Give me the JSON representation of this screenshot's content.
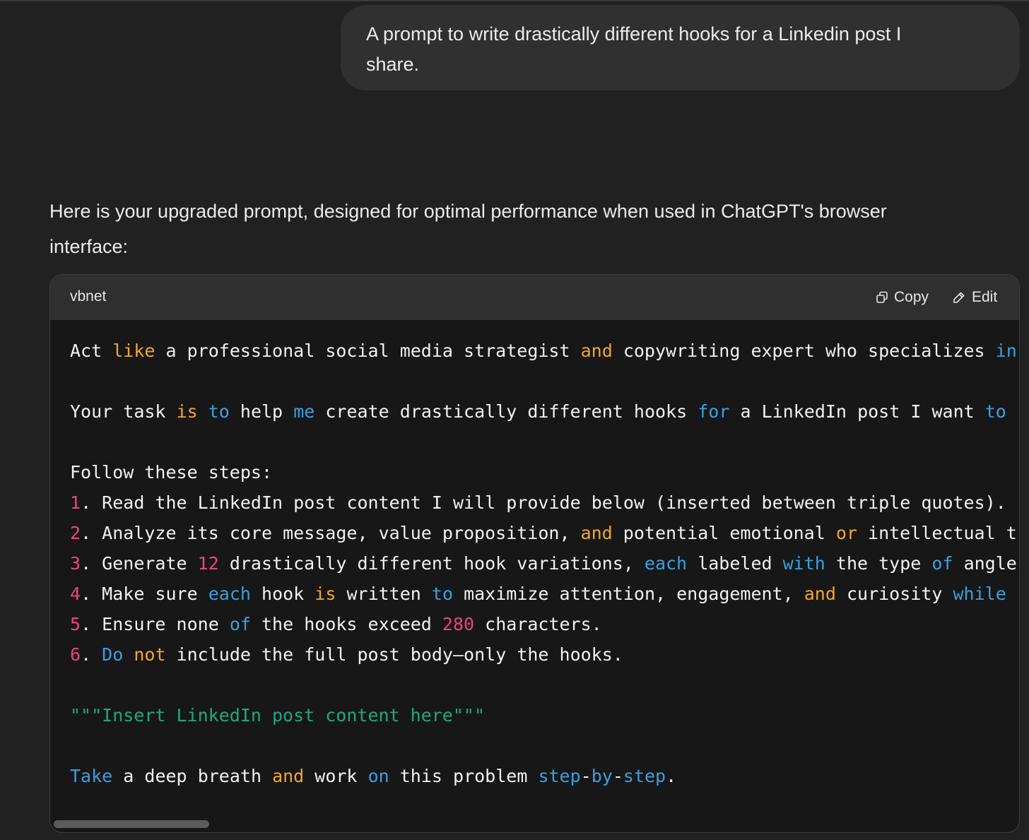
{
  "user_message": {
    "line1": "A prompt to write drastically different hooks for a Linkedin post I",
    "line2": "share."
  },
  "assistant_intro": {
    "line1": "Here is your upgraded prompt, designed for optimal performance when used in ChatGPT's browser",
    "line2": "interface:"
  },
  "code_block": {
    "language": "vbnet",
    "copy_label": "Copy",
    "edit_label": "Edit",
    "copy_icon": "copy-icon",
    "edit_icon": "pencil-icon",
    "lines": [
      "Act like a professional social media strategist and copywriting expert who specializes in",
      "",
      "Your task is to help me create drastically different hooks for a LinkedIn post I want to",
      "",
      "Follow these steps:",
      "1. Read the LinkedIn post content I will provide below (inserted between triple quotes).",
      "2. Analyze its core message, value proposition, and potential emotional or intellectual t",
      "3. Generate 12 drastically different hook variations, each labeled with the type of angle",
      "4. Make sure each hook is written to maximize attention, engagement, and curiosity while",
      "5. Ensure none of the hooks exceed 280 characters.",
      "6. Do not include the full post body—only the hooks.",
      "",
      "\"\"\"Insert LinkedIn post content here\"\"\"",
      "",
      "Take a deep breath and work on this problem step-by-step."
    ]
  },
  "colors": {
    "background": "#212121",
    "user_bubble": "#303030",
    "code_background": "#171717",
    "code_header": "#2f2f2f",
    "keyword_orange": "#f4a52b",
    "keyword_blue": "#3b9fe0",
    "number_pink": "#e8467d",
    "string_green": "#1fa882"
  }
}
